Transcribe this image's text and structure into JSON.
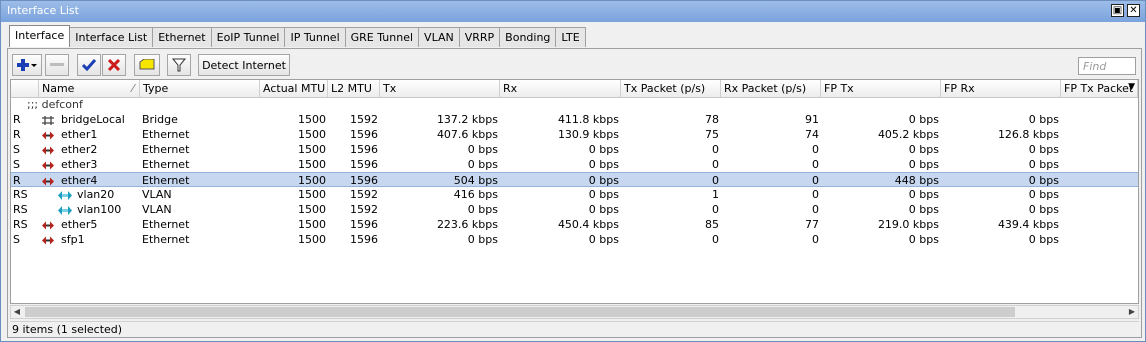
{
  "window": {
    "title": "Interface List"
  },
  "tabs": [
    {
      "label": "Interface",
      "active": true
    },
    {
      "label": "Interface List"
    },
    {
      "label": "Ethernet"
    },
    {
      "label": "EoIP Tunnel"
    },
    {
      "label": "IP Tunnel"
    },
    {
      "label": "GRE Tunnel"
    },
    {
      "label": "VLAN"
    },
    {
      "label": "VRRP"
    },
    {
      "label": "Bonding"
    },
    {
      "label": "LTE"
    }
  ],
  "toolbar": {
    "add_icon": "plus-icon",
    "remove_icon": "minus-icon",
    "enable_icon": "check-icon",
    "disable_icon": "x-icon",
    "comment_icon": "comment-icon",
    "filter_icon": "filter-icon",
    "detect_label": "Detect Internet",
    "find_placeholder": "Find"
  },
  "table": {
    "columns": [
      "Name",
      "Type",
      "Actual MTU",
      "L2 MTU",
      "Tx",
      "Rx",
      "Tx Packet (p/s)",
      "Rx Packet (p/s)",
      "FP Tx",
      "FP Rx",
      "FP Tx Packet"
    ],
    "comment": ";;; defconf",
    "rows": [
      {
        "flag": "R",
        "name": "bridgeLocal",
        "type": "Bridge",
        "mtu": "1500",
        "l2mtu": "1592",
        "tx": "137.2 kbps",
        "rx": "411.8 kbps",
        "txp": "78",
        "rxp": "91",
        "fptx": "0 bps",
        "fprx": "0 bps",
        "icon": "bridge-icon",
        "indent": 0
      },
      {
        "flag": "R",
        "name": "ether1",
        "type": "Ethernet",
        "mtu": "1500",
        "l2mtu": "1596",
        "tx": "407.6 kbps",
        "rx": "130.9 kbps",
        "txp": "75",
        "rxp": "74",
        "fptx": "405.2 kbps",
        "fprx": "126.8 kbps",
        "icon": "ethernet-icon",
        "indent": 0
      },
      {
        "flag": "S",
        "name": "ether2",
        "type": "Ethernet",
        "mtu": "1500",
        "l2mtu": "1596",
        "tx": "0 bps",
        "rx": "0 bps",
        "txp": "0",
        "rxp": "0",
        "fptx": "0 bps",
        "fprx": "0 bps",
        "icon": "ethernet-icon",
        "indent": 0
      },
      {
        "flag": "S",
        "name": "ether3",
        "type": "Ethernet",
        "mtu": "1500",
        "l2mtu": "1596",
        "tx": "0 bps",
        "rx": "0 bps",
        "txp": "0",
        "rxp": "0",
        "fptx": "0 bps",
        "fprx": "0 bps",
        "icon": "ethernet-icon",
        "indent": 0
      },
      {
        "flag": "R",
        "name": "ether4",
        "type": "Ethernet",
        "mtu": "1500",
        "l2mtu": "1596",
        "tx": "504 bps",
        "rx": "0 bps",
        "txp": "0",
        "rxp": "0",
        "fptx": "448 bps",
        "fprx": "0 bps",
        "icon": "ethernet-icon",
        "indent": 0,
        "selected": true
      },
      {
        "flag": "RS",
        "name": "vlan20",
        "type": "VLAN",
        "mtu": "1500",
        "l2mtu": "1592",
        "tx": "416 bps",
        "rx": "0 bps",
        "txp": "1",
        "rxp": "0",
        "fptx": "0 bps",
        "fprx": "0 bps",
        "icon": "vlan-icon",
        "indent": 1
      },
      {
        "flag": "RS",
        "name": "vlan100",
        "type": "VLAN",
        "mtu": "1500",
        "l2mtu": "1592",
        "tx": "0 bps",
        "rx": "0 bps",
        "txp": "0",
        "rxp": "0",
        "fptx": "0 bps",
        "fprx": "0 bps",
        "icon": "vlan-icon",
        "indent": 1
      },
      {
        "flag": "RS",
        "name": "ether5",
        "type": "Ethernet",
        "mtu": "1500",
        "l2mtu": "1596",
        "tx": "223.6 kbps",
        "rx": "450.4 kbps",
        "txp": "85",
        "rxp": "77",
        "fptx": "219.0 kbps",
        "fprx": "439.4 kbps",
        "icon": "ethernet-icon",
        "indent": 0
      },
      {
        "flag": "S",
        "name": "sfp1",
        "type": "Ethernet",
        "mtu": "1500",
        "l2mtu": "1596",
        "tx": "0 bps",
        "rx": "0 bps",
        "txp": "0",
        "rxp": "0",
        "fptx": "0 bps",
        "fprx": "0 bps",
        "icon": "ethernet-icon",
        "indent": 0
      }
    ]
  },
  "status": "9 items (1 selected)",
  "colors": {
    "titlebar": "#7aa3dd",
    "selected_row": "#c6d7ef",
    "ethernet_icon": "#b5231c",
    "vlan_icon": "#1e9fbf"
  }
}
